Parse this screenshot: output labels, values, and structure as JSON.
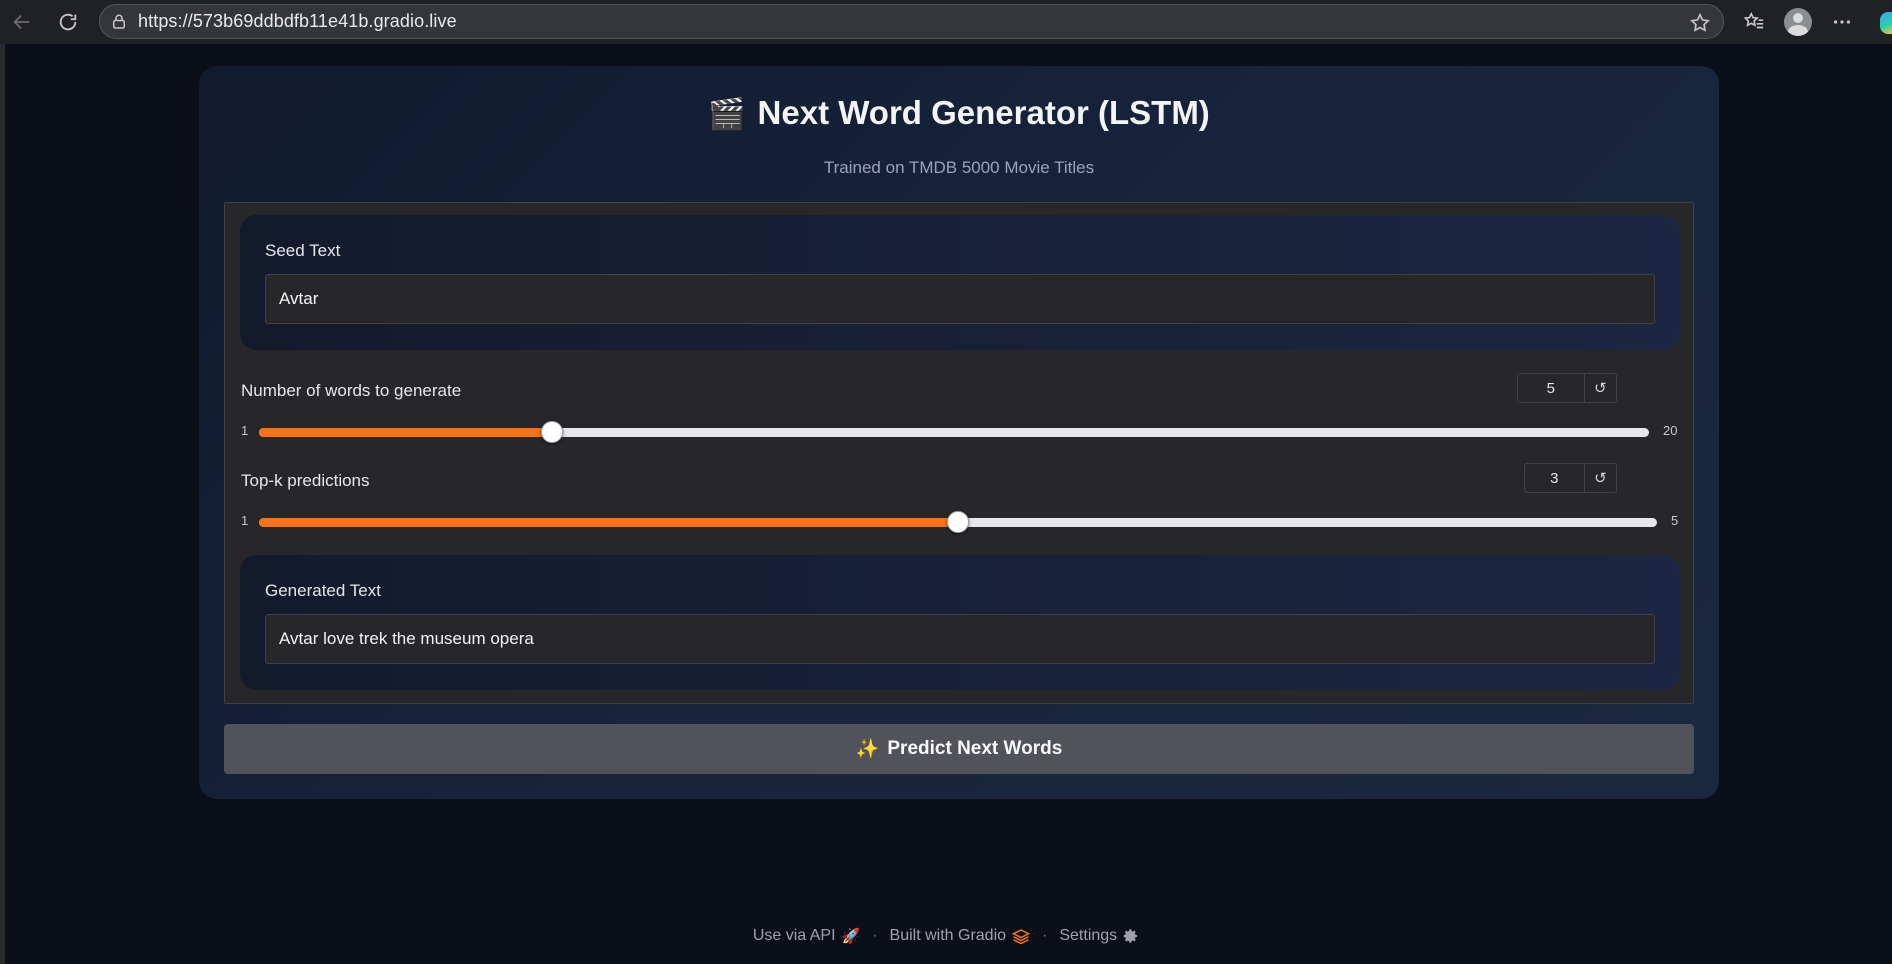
{
  "browser": {
    "url": "https://573b69ddbdfb11e41b.gradio.live"
  },
  "app": {
    "title_emoji": "🎬",
    "title": "Next Word Generator (LSTM)",
    "subtitle": "Trained on TMDB 5000 Movie Titles"
  },
  "seed": {
    "label": "Seed Text",
    "value": "Avtar"
  },
  "words_slider": {
    "label": "Number of words to generate",
    "value": "5",
    "min": "1",
    "max": "20",
    "fraction": 0.2105
  },
  "topk_slider": {
    "label": "Top-k predictions",
    "value": "3",
    "min": "1",
    "max": "5",
    "fraction": 0.5
  },
  "output": {
    "label": "Generated Text",
    "value": "Avtar love trek the museum opera"
  },
  "predict_button": {
    "icon": "✨",
    "label": "Predict Next Words"
  },
  "footer": {
    "api_label": "Use via API",
    "built_label": "Built with Gradio",
    "settings_label": "Settings",
    "separator": "·"
  },
  "colors": {
    "accent": "#f97316",
    "button": "#52525b"
  }
}
